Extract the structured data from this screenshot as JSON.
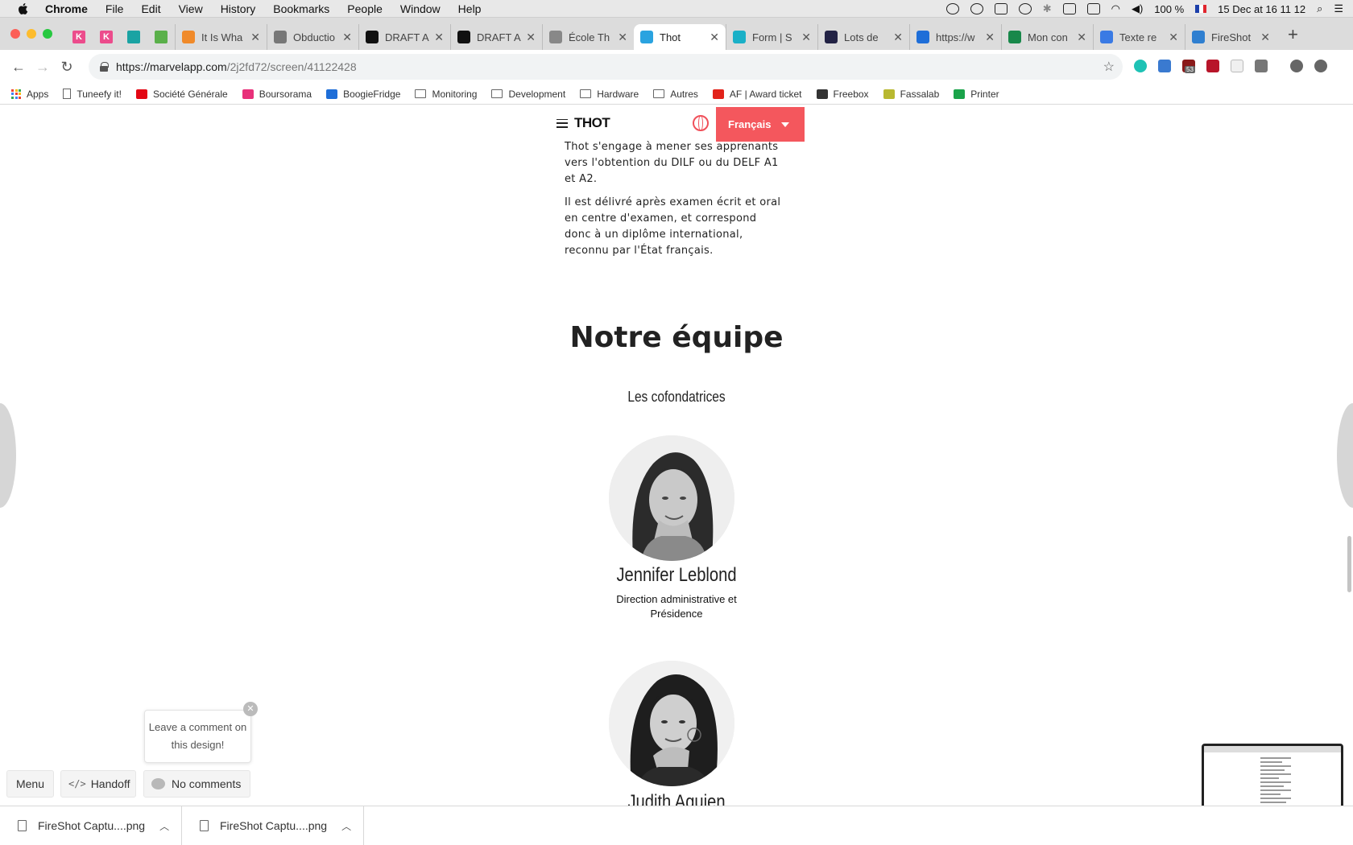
{
  "menubar": {
    "items": [
      "Chrome",
      "File",
      "Edit",
      "View",
      "History",
      "Bookmarks",
      "People",
      "Window",
      "Help"
    ],
    "battery": "100 %",
    "datetime": "15 Dec at  16 11 12"
  },
  "tabs": [
    {
      "title": "It Is Wha",
      "color": "#f08a2a"
    },
    {
      "title": "Obductio",
      "color": "#777777"
    },
    {
      "title": "DRAFT A",
      "color": "#111111"
    },
    {
      "title": "DRAFT A",
      "color": "#111111"
    },
    {
      "title": "École Th",
      "color": "#888888"
    },
    {
      "title": "Thot",
      "color": "#2aa3e0",
      "active": true
    },
    {
      "title": "Form | S",
      "color": "#1ab0c7"
    },
    {
      "title": "Lots de",
      "color": "#222244"
    },
    {
      "title": "https://w",
      "color": "#1e6ed8"
    },
    {
      "title": "Mon con",
      "color": "#18884a"
    },
    {
      "title": "Texte re",
      "color": "#3a7ae4"
    },
    {
      "title": "FireShot",
      "color": "#2f7fd0"
    }
  ],
  "address": {
    "host": "https://marvelapp.com",
    "path": "/2j2fd72/screen/41122428"
  },
  "extension_badge": "53",
  "bookmarks": [
    {
      "label": "Apps",
      "type": "apps"
    },
    {
      "label": "Tuneefy it!",
      "type": "page"
    },
    {
      "label": "Société Générale",
      "type": "sg"
    },
    {
      "label": "Boursorama",
      "type": "bourso"
    },
    {
      "label": "BoogieFridge",
      "type": "dsm"
    },
    {
      "label": "Monitoring",
      "type": "folder"
    },
    {
      "label": "Development",
      "type": "folder"
    },
    {
      "label": "Hardware",
      "type": "folder"
    },
    {
      "label": "Autres",
      "type": "folder"
    },
    {
      "label": "AF | Award ticket",
      "type": "af"
    },
    {
      "label": "Freebox",
      "type": "freebox"
    },
    {
      "label": "Fassalab",
      "type": "fassalab"
    },
    {
      "label": "Printer",
      "type": "printer"
    }
  ],
  "site": {
    "logo": "THOT",
    "language": "Français",
    "accent": "#f4575d",
    "para1": "Thot s'engage à mener ses apprenants vers l'obtention du DILF ou du DELF A1 et A2.",
    "para2": "Il est délivré après examen écrit et oral en centre d'examen, et correspond donc à un diplôme international, reconnu par l'État français.",
    "team_title": "Notre équipe",
    "team_subtitle": "Les cofondatrices",
    "members": [
      {
        "name": "Jennifer Leblond",
        "role": "Direction administrative et Présidence"
      },
      {
        "name": "Judith Aguien",
        "role": ""
      }
    ]
  },
  "marvel": {
    "tooltip": "Leave a comment on this design!",
    "menu": "Menu",
    "handoff": "Handoff",
    "comments": "No comments"
  },
  "downloads": [
    "FireShot Captu....png",
    "FireShot Captu....png"
  ]
}
